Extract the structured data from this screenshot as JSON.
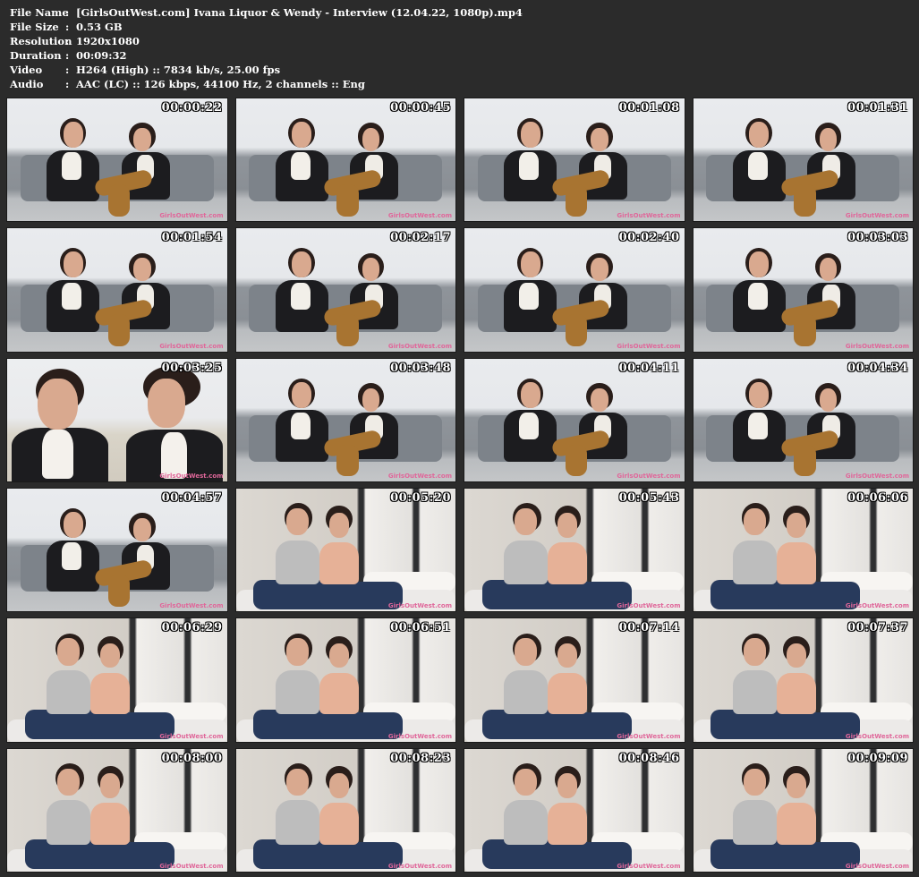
{
  "info": {
    "rows": [
      {
        "label": "File Name",
        "value": "[GirlsOutWest.com] Ivana Liquor & Wendy - Interview (12.04.22, 1080p).mp4"
      },
      {
        "label": "File Size",
        "value": "0.53 GB"
      },
      {
        "label": "Resolution",
        "value": "1920x1080"
      },
      {
        "label": "Duration",
        "value": "00:09:32"
      },
      {
        "label": "Video",
        "value": "H264 (High) :: 7834 kb/s, 25.00 fps"
      },
      {
        "label": "Audio",
        "value": "AAC (LC) :: 126 kbps, 44100 Hz, 2 channels :: Eng"
      }
    ],
    "separator": ":"
  },
  "thumbnails": [
    {
      "time": "00:00:22",
      "scene": "interview"
    },
    {
      "time": "00:00:45",
      "scene": "interview"
    },
    {
      "time": "00:01:08",
      "scene": "interview"
    },
    {
      "time": "00:01:31",
      "scene": "interview"
    },
    {
      "time": "00:01:54",
      "scene": "interview"
    },
    {
      "time": "00:02:17",
      "scene": "interview"
    },
    {
      "time": "00:02:40",
      "scene": "interview"
    },
    {
      "time": "00:03:03",
      "scene": "interview"
    },
    {
      "time": "00:03:25",
      "scene": "closeup"
    },
    {
      "time": "00:03:48",
      "scene": "interview"
    },
    {
      "time": "00:04:11",
      "scene": "interview"
    },
    {
      "time": "00:04:34",
      "scene": "interview"
    },
    {
      "time": "00:04:57",
      "scene": "interview"
    },
    {
      "time": "00:05:20",
      "scene": "window"
    },
    {
      "time": "00:05:43",
      "scene": "window"
    },
    {
      "time": "00:06:06",
      "scene": "window"
    },
    {
      "time": "00:06:29",
      "scene": "window"
    },
    {
      "time": "00:06:51",
      "scene": "window"
    },
    {
      "time": "00:07:14",
      "scene": "window"
    },
    {
      "time": "00:07:37",
      "scene": "window"
    },
    {
      "time": "00:08:00",
      "scene": "window"
    },
    {
      "time": "00:08:23",
      "scene": "window"
    },
    {
      "time": "00:08:46",
      "scene": "window"
    },
    {
      "time": "00:09:09",
      "scene": "window"
    }
  ],
  "watermark": "GirlsOutWest.com",
  "colors": {
    "background": "#2b2b2b",
    "text": "#ffffff",
    "watermark": "#e0679a",
    "jacket": "#1c1c1f",
    "tights": "#a87431",
    "jeans": "#283a5c"
  }
}
